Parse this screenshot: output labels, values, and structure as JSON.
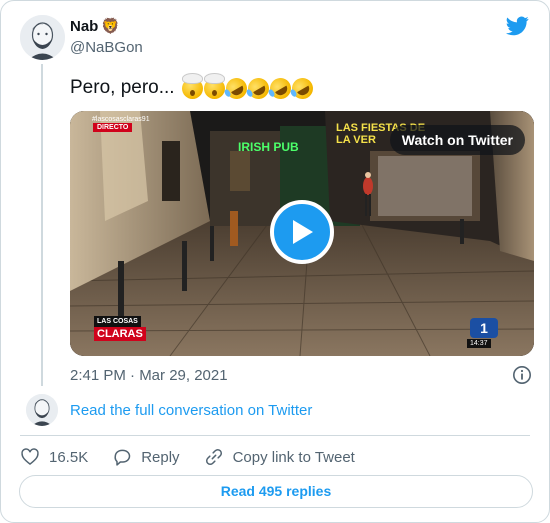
{
  "user": {
    "display_name": "Nab",
    "name_emoji": "🦁",
    "handle": "@NaBGon"
  },
  "tweet": {
    "text": "Pero, pero...",
    "emojis": [
      "exploding-head",
      "exploding-head",
      "rolling-on-floor-laughing",
      "rolling-on-floor-laughing",
      "rolling-on-floor-laughing",
      "rolling-on-floor-laughing"
    ],
    "timestamp": "2:41 PM · Mar 29, 2021"
  },
  "media": {
    "watch_label": "Watch on Twitter",
    "overlay_hashtag": "#lascosasclaras91",
    "overlay_live": "DIRECTO",
    "pub_sign": "IRISH PUB",
    "fiestas_sign": "LAS FIESTAS DE\nLA VER...",
    "show_logo_line1": "LAS COSAS",
    "show_logo_line2": "CLARAS",
    "channel_number": "1",
    "channel_time": "14:37"
  },
  "conversation": {
    "link_label": "Read the full conversation on Twitter"
  },
  "actions": {
    "like_count": "16.5K",
    "reply_label": "Reply",
    "copy_label": "Copy link to Tweet"
  },
  "footer": {
    "replies_label": "Read 495 replies"
  },
  "colors": {
    "accent": "#1d9bf0",
    "text_primary": "#0f1419",
    "text_secondary": "#536471",
    "border": "#cfd9de"
  },
  "icons": [
    "twitter-bird-icon",
    "play-icon",
    "info-icon",
    "heart-icon",
    "reply-bubble-icon",
    "link-icon"
  ]
}
